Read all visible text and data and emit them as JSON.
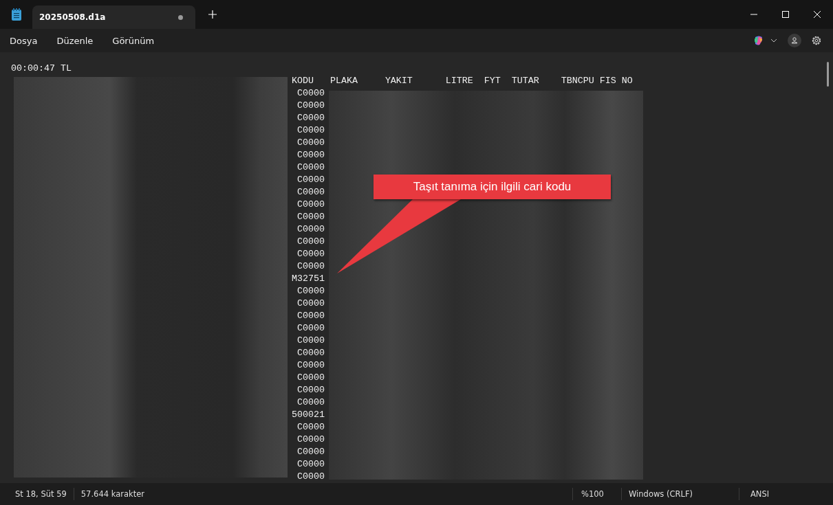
{
  "window": {
    "tab_title": "20250508.d1a",
    "unsaved": true
  },
  "menu": [
    "Dosya",
    "Düzenle",
    "Görünüm"
  ],
  "editor": {
    "first_line": "00:00:47 TL",
    "header": "KODU   PLAKA     YAKIT      LITRE  FYT  TUTAR    TBNCPU FIS NO",
    "codes": [
      "C0000",
      "C0000",
      "C0000",
      "C0000",
      "C0000",
      "C0000",
      "C0000",
      "C0000",
      "C0000",
      "C0000",
      "C0000",
      "C0000",
      "C0000",
      "C0000",
      "C0000",
      "M32751",
      "C0000",
      "C0000",
      "C0000",
      "C0000",
      "C0000",
      "C0000",
      "C0000",
      "C0000",
      "C0000",
      "C0000",
      "500021",
      "C0000",
      "C0000",
      "C0000",
      "C0000",
      "C0000"
    ]
  },
  "callout": {
    "text": "Taşıt tanıma için ilgili cari kodu"
  },
  "status_bar": {
    "position": "St 18, Süt 59",
    "characters": "57.644 karakter",
    "zoom": "%100",
    "line_ending": "Windows (CRLF)",
    "encoding": "ANSI"
  }
}
